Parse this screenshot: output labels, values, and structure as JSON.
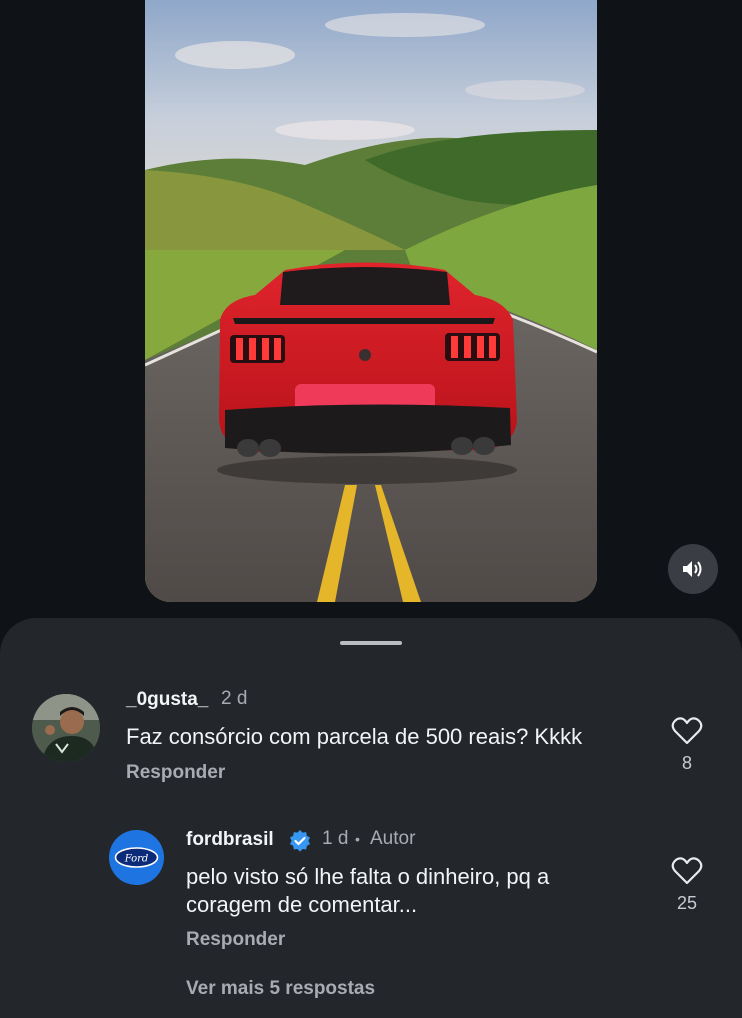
{
  "video": {
    "sound_icon": "volume-icon"
  },
  "comments": [
    {
      "username": "_0gusta_",
      "time": "2 d",
      "text": "Faz consórcio com parcela de 500 reais? Kkkk",
      "reply_label": "Responder",
      "likes": "8",
      "like_icon": "heart-icon"
    }
  ],
  "reply": {
    "username": "fordbrasil",
    "verified_icon": "verified-badge-icon",
    "time": "1 d",
    "separator": "•",
    "author_tag": "Autor",
    "text_line1": "pelo visto só lhe falta o dinheiro, pq a",
    "text_line2": "coragem de comentar...",
    "reply_label": "Responder",
    "likes": "25",
    "like_icon": "heart-icon",
    "avatar_logo_text": "Ford"
  },
  "more_replies": "Ver mais 5 respostas",
  "colors": {
    "background": "#0f1216",
    "sheet": "#23262b",
    "verified": "#3897f0",
    "ford_blue": "#1e74e0"
  }
}
